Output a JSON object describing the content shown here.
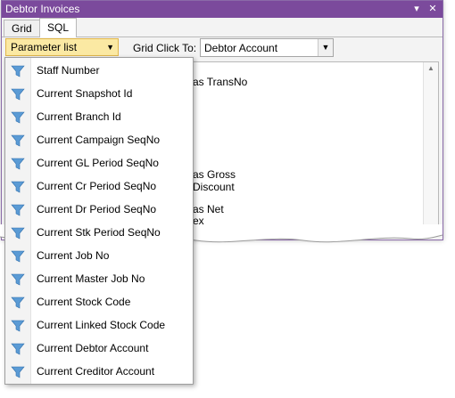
{
  "window": {
    "title": "Debtor Invoices",
    "pin_icon": "pin-icon",
    "close_icon": "close-icon"
  },
  "tabs": [
    {
      "label": "Grid",
      "active": false
    },
    {
      "label": "SQL",
      "active": true
    }
  ],
  "toolbar": {
    "parameter_list_label": "Parameter list",
    "grid_click_label": "Grid Click To:",
    "grid_click_value": "Debtor Account"
  },
  "sql_fragments": [
    "as TransNo",
    "as Gross",
    "Discount",
    "as Net",
    "ex"
  ],
  "dropdown": {
    "icon": "filter-icon",
    "items": [
      "Staff Number",
      "Current Snapshot Id",
      "Current Branch Id",
      "Current Campaign SeqNo",
      "Current GL Period SeqNo",
      "Current Cr Period SeqNo",
      "Current Dr Period SeqNo",
      "Current Stk Period SeqNo",
      "Current Job No",
      "Current Master Job No",
      "Current Stock Code",
      "Current Linked Stock Code",
      "Current Debtor Account",
      "Current Creditor Account"
    ]
  },
  "colors": {
    "titlebar": "#7b4a9c",
    "param_button": "#fbe9a3",
    "filter_icon": "#5b9bd5"
  }
}
